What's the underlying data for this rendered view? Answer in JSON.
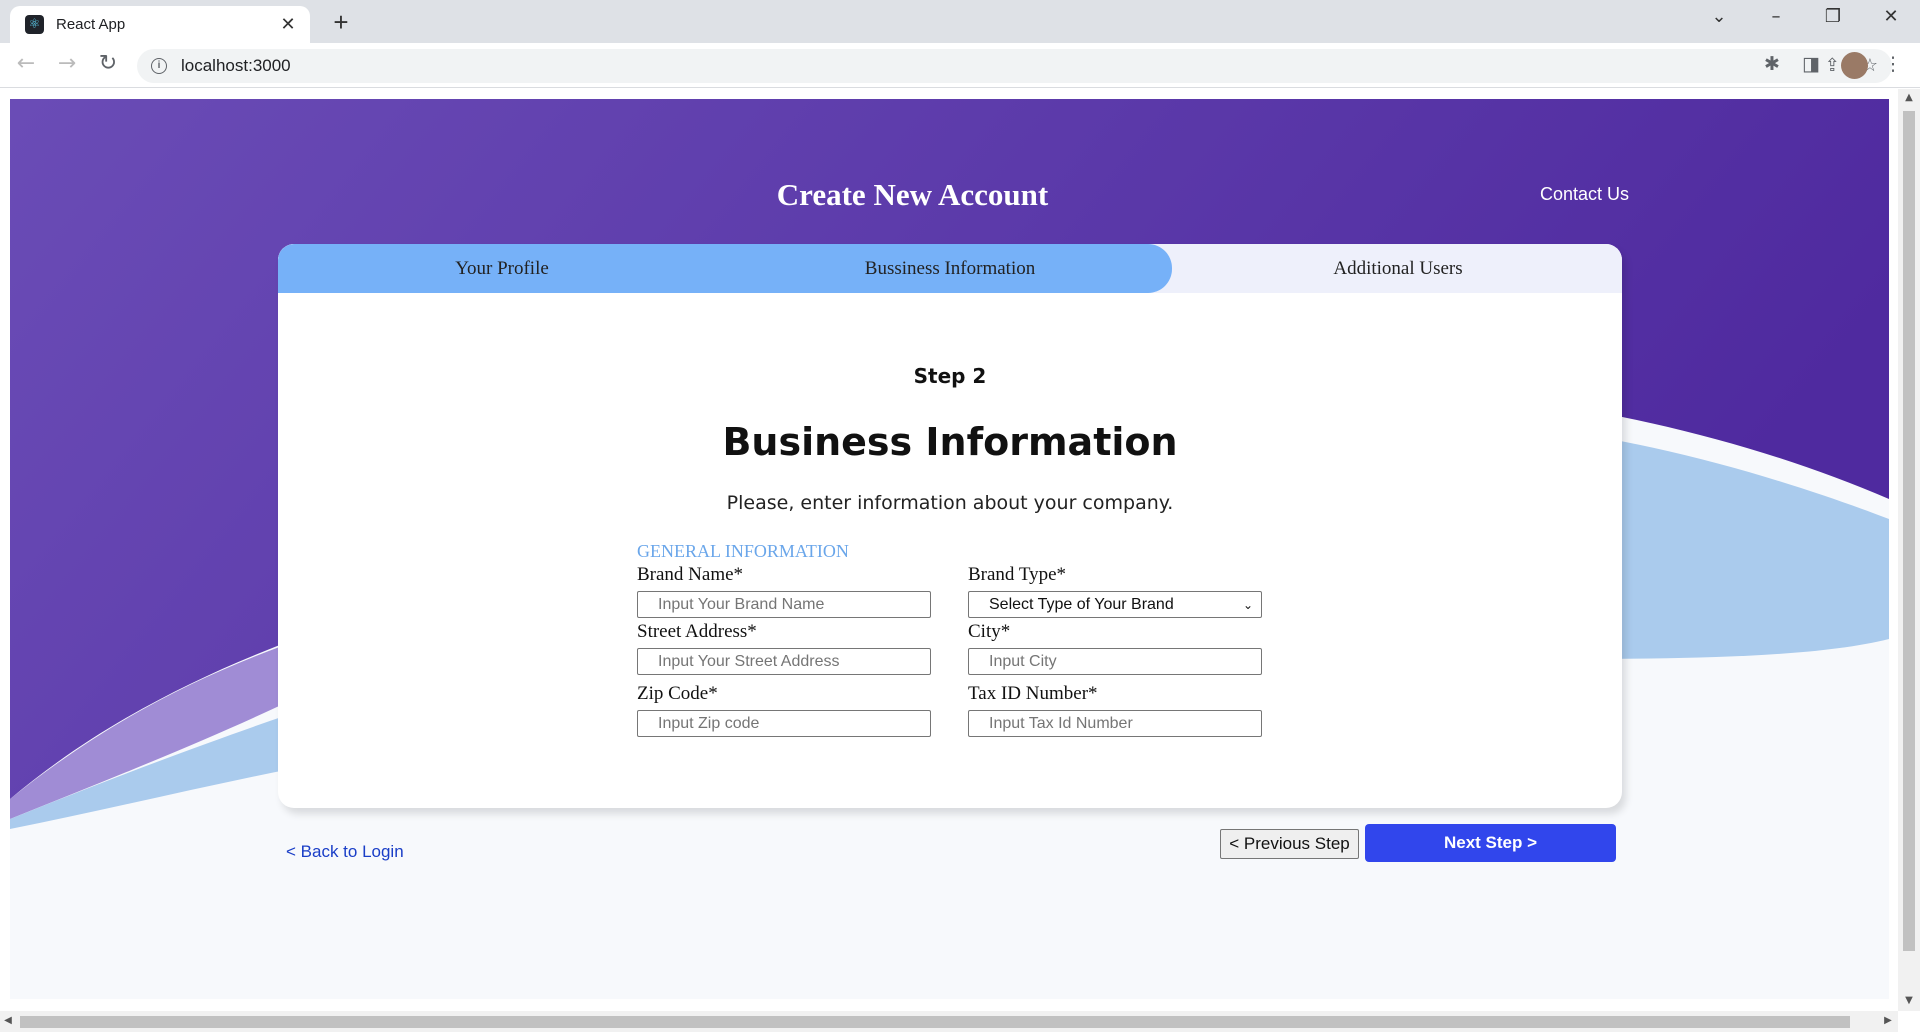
{
  "browser": {
    "tab_title": "React App",
    "tab_icon": "react-logo-icon",
    "url": "localhost:3000"
  },
  "header": {
    "title": "Create New Account",
    "contact": "Contact Us"
  },
  "steps": [
    {
      "label": "Your Profile",
      "active": true
    },
    {
      "label": "Bussiness Information",
      "active": true
    },
    {
      "label": "Additional Users",
      "active": false
    }
  ],
  "form": {
    "step_label": "Step 2",
    "heading": "Business Information",
    "subtitle": "Please, enter information about your company.",
    "section_title": "GENERAL INFORMATION",
    "fields": {
      "brand_name": {
        "label": "Brand Name*",
        "placeholder": "Input Your Brand Name",
        "value": ""
      },
      "brand_type": {
        "label": "Brand Type*",
        "selected": "Select Type of Your Brand"
      },
      "street_address": {
        "label": "Street Address*",
        "placeholder": "Input Your Street Address",
        "value": ""
      },
      "city": {
        "label": "City*",
        "placeholder": "Input City",
        "value": ""
      },
      "zip_code": {
        "label": "Zip Code*",
        "placeholder": "Input Zip code",
        "value": ""
      },
      "tax_id": {
        "label": "Tax ID Number*",
        "placeholder": "Input Tax Id Number",
        "value": ""
      }
    }
  },
  "footer": {
    "back": "< Back to Login",
    "previous": "< Previous Step",
    "next": "Next Step >"
  },
  "colors": {
    "header_purple": "#5a3aa8",
    "tab_active": "#76b1f8",
    "tab_inactive": "#eef0fb",
    "wave_light": "#aacbed",
    "section_blue": "#6aa6ea",
    "next_button": "#3146ec",
    "link": "#1a3ec7"
  }
}
